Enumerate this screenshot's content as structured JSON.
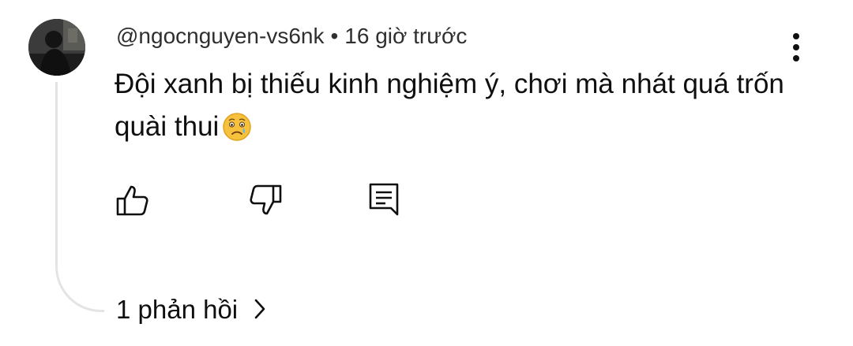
{
  "comment": {
    "author": "@ngocnguyen-vs6nk",
    "separator": "•",
    "time": "16 giờ trước",
    "text": "Đội xanh bị thiếu kinh nghiệm ý, chơi mà nhát quá trốn quài thui",
    "emoji": "crying-face-emoji"
  },
  "actions": {
    "like_icon": "thumb-up-icon",
    "dislike_icon": "thumb-down-icon",
    "reply_icon": "comment-reply-icon",
    "menu_icon": "more-vertical-icon"
  },
  "replies": {
    "label": "1 phản hồi",
    "chevron_icon": "chevron-right-icon"
  },
  "colors": {
    "text": "#0f0f0f",
    "meta": "#2f2f2f",
    "thread_line": "#e4e4e4",
    "emoji_face": "#f6c23e"
  }
}
